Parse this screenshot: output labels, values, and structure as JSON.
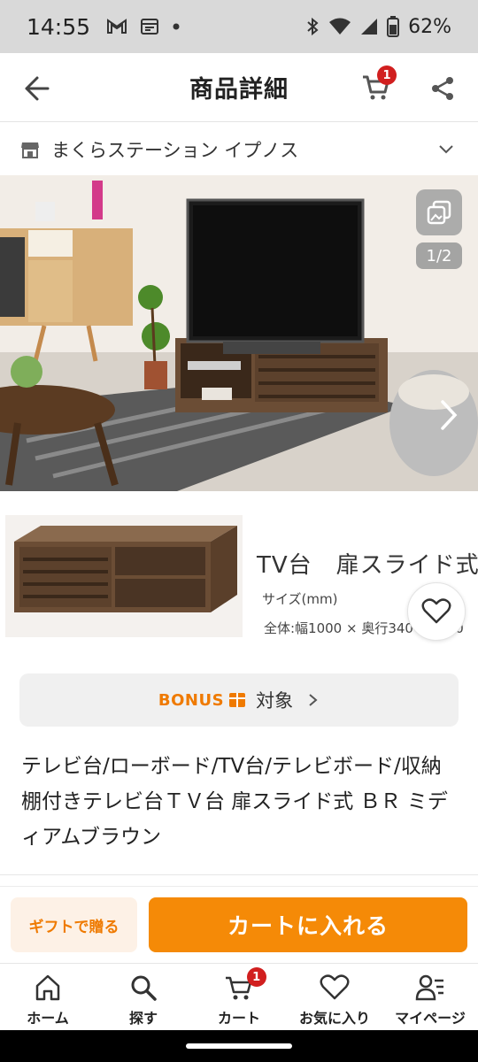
{
  "status_bar": {
    "time": "14:55",
    "battery": "62%"
  },
  "header": {
    "title": "商品詳細",
    "cart_count": "1"
  },
  "shop": {
    "name": "まくらステーション イプノス"
  },
  "gallery": {
    "counter": "1/2"
  },
  "sub_image": {
    "title": "TV台　扉スライド式",
    "size_label": "サイズ(mm)",
    "dims": "全体:幅1000 × 奥行340 ×　　0"
  },
  "bonus": {
    "word": "BONUS",
    "label": "対象"
  },
  "product": {
    "title": "テレビ台/ローボード/TV台/テレビボード/収納棚付きテレビ台ＴＶ台 扉スライド式 ＢＲ ミディアムブラウン"
  },
  "actions": {
    "gift": "ギフトで贈る",
    "add_to_cart": "カートに入れる"
  },
  "bottom_nav": {
    "items": [
      {
        "label": "ホーム",
        "icon": "home-icon"
      },
      {
        "label": "探す",
        "icon": "search-icon"
      },
      {
        "label": "カート",
        "icon": "cart-icon",
        "badge": "1"
      },
      {
        "label": "お気に入り",
        "icon": "heart-icon"
      },
      {
        "label": "マイページ",
        "icon": "user-icon"
      }
    ]
  },
  "colors": {
    "accent": "#f58a07",
    "badge": "#d11f1f",
    "gift_bg": "#fdf1e6"
  }
}
